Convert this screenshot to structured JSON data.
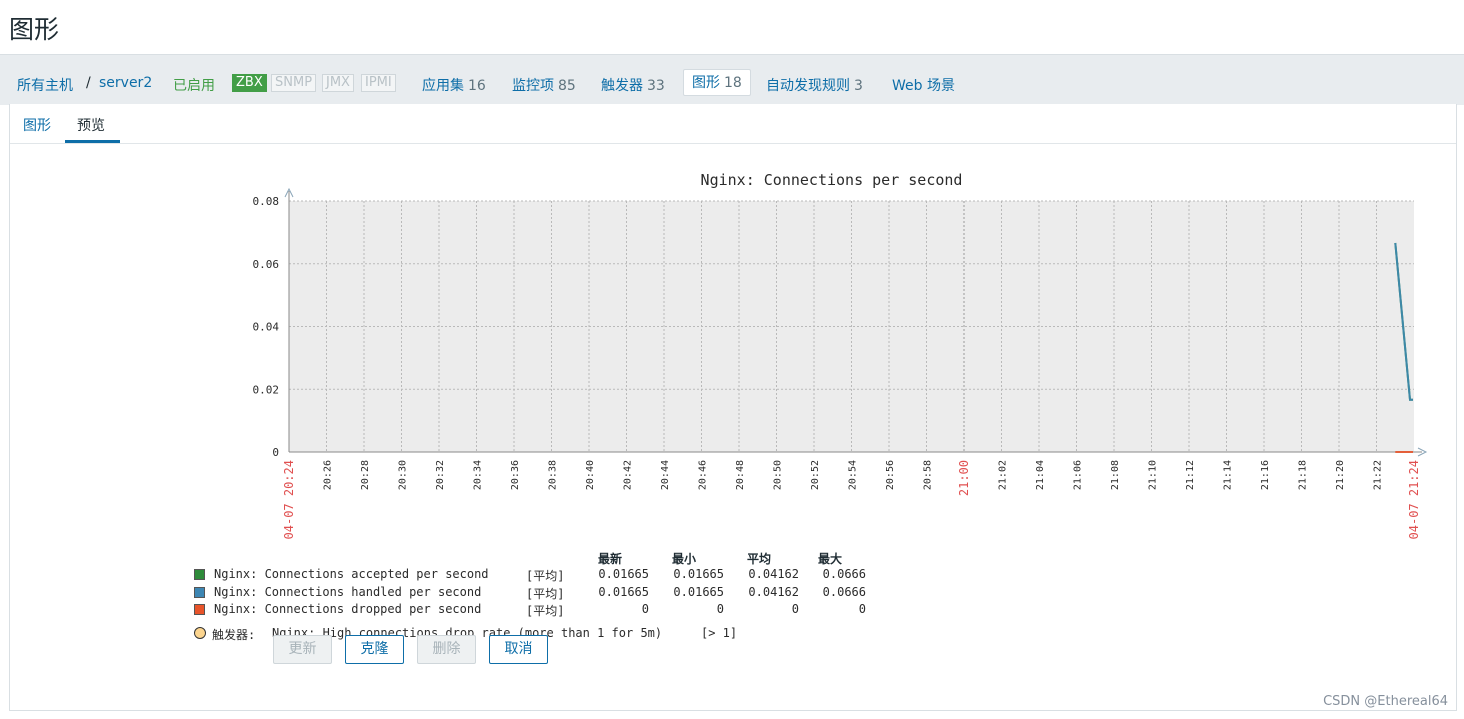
{
  "page": {
    "title": "图形"
  },
  "nav": {
    "breadcrumb_all_hosts": "所有主机",
    "separator": "/",
    "host": "server2",
    "status": "已启用",
    "protocols": [
      "ZBX",
      "SNMP",
      "JMX",
      "IPMI"
    ],
    "links": [
      {
        "label": "应用集",
        "count": "16"
      },
      {
        "label": "监控项",
        "count": "85"
      },
      {
        "label": "触发器",
        "count": "33"
      },
      {
        "label": "图形",
        "count": "18"
      },
      {
        "label": "自动发现规则",
        "count": "3"
      },
      {
        "label": "Web 场景",
        "count": ""
      }
    ]
  },
  "subtabs": [
    {
      "label": "图形",
      "active": false
    },
    {
      "label": "预览",
      "active": true
    }
  ],
  "chart_data": {
    "type": "line",
    "title": "Nginx: Connections per second",
    "xlabel": "",
    "ylabel": "",
    "ylim": [
      0,
      0.08
    ],
    "y_ticks": [
      "0.08",
      "0.06",
      "0.04",
      "0.02",
      "0"
    ],
    "x_ticks": [
      "04-07 20:24",
      "20:26",
      "20:28",
      "20:30",
      "20:32",
      "20:34",
      "20:36",
      "20:38",
      "20:40",
      "20:42",
      "20:44",
      "20:46",
      "20:48",
      "20:50",
      "20:52",
      "20:54",
      "20:56",
      "20:58",
      "21:00",
      "21:02",
      "21:04",
      "21:06",
      "21:08",
      "21:10",
      "21:12",
      "21:14",
      "21:16",
      "21:18",
      "21:20",
      "21:22",
      "04-07 21:24"
    ],
    "grid": true,
    "series": [
      {
        "name": "Nginx: Connections accepted per second",
        "color": "#2e8b3a",
        "x": [
          "21:23",
          "21:24"
        ],
        "values": [
          0.0666,
          0.01665
        ]
      },
      {
        "name": "Nginx: Connections handled per second",
        "color": "#3d86b3",
        "x": [
          "21:23",
          "21:24"
        ],
        "values": [
          0.0666,
          0.01665
        ]
      },
      {
        "name": "Nginx: Connections dropped per second",
        "color": "#e8542a",
        "x": [
          "21:23",
          "21:24"
        ],
        "values": [
          0,
          0
        ]
      }
    ]
  },
  "legend": {
    "headers": {
      "last": "最新",
      "min": "最小",
      "avg": "平均",
      "max": "最大"
    },
    "rows": [
      {
        "name": "Nginx: Connections accepted per second",
        "func": "[平均]",
        "last": "0.01665",
        "min": "0.01665",
        "avg": "0.04162",
        "max": "0.0666",
        "color": "#2e8b3a"
      },
      {
        "name": "Nginx: Connections handled per second",
        "func": "[平均]",
        "last": "0.01665",
        "min": "0.01665",
        "avg": "0.04162",
        "max": "0.0666",
        "color": "#3d86b3"
      },
      {
        "name": "Nginx: Connections dropped per second",
        "func": "[平均]",
        "last": "0",
        "min": "0",
        "avg": "0",
        "max": "0",
        "color": "#e8542a"
      }
    ],
    "trigger": {
      "prefix": "触发器:",
      "text": "Nginx: High connections drop rate (more than 1 for 5m)",
      "cond": "[> 1]",
      "color": "#fcd58f"
    }
  },
  "buttons": {
    "update": "更新",
    "clone": "克隆",
    "delete": "删除",
    "cancel": "取消"
  },
  "watermark": "CSDN @Ethereal64"
}
